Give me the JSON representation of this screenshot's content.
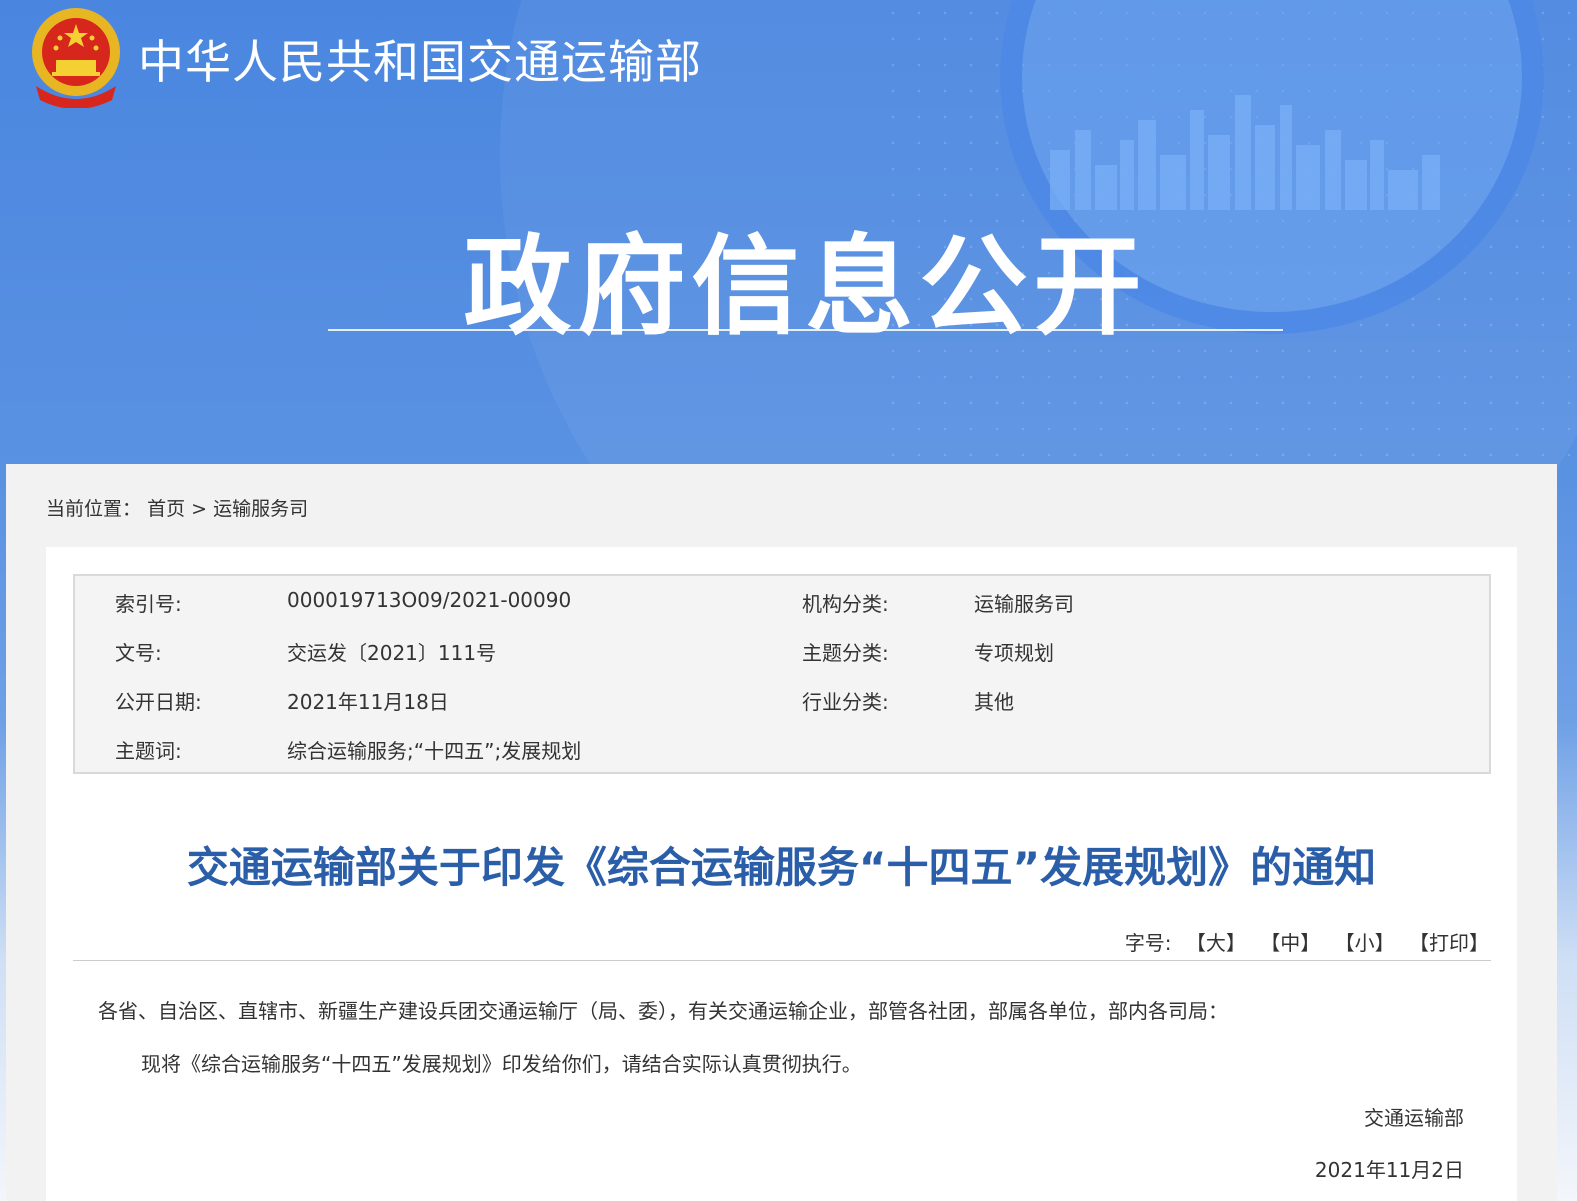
{
  "header": {
    "ministry_name": "中华人民共和国交通运输部",
    "section_title": "政府信息公开"
  },
  "breadcrumb": {
    "prefix": "当前位置：",
    "home": "首页",
    "separator": ">",
    "current": "运输服务司"
  },
  "meta": {
    "index_label": "索引号:",
    "index_value": "000019713O09/2021-00090",
    "org_label": "机构分类:",
    "org_value": "运输服务司",
    "docno_label": "文号:",
    "docno_value": "交运发〔2021〕111号",
    "topic_label": "主题分类:",
    "topic_value": "专项规划",
    "date_label": "公开日期:",
    "date_value": "2021年11月18日",
    "industry_label": "行业分类:",
    "industry_value": "其他",
    "keywords_label": "主题词:",
    "keywords_value": "综合运输服务;“十四五”;发展规划"
  },
  "article": {
    "title": "交通运输部关于印发《综合运输服务“十四五”发展规划》的通知",
    "font_size_label": "字号:",
    "font_large": "【大】",
    "font_medium": "【中】",
    "font_small": "【小】",
    "print": "【打印】",
    "addressee": "各省、自治区、直辖市、新疆生产建设兵团交通运输厅（局、委），有关交通运输企业，部管各社团，部属各单位，部内各司局：",
    "body": "现将《综合运输服务“十四五”发展规划》印发给你们，请结合实际认真贯彻执行。",
    "signature": "交通运输部",
    "sign_date": "2021年11月2日"
  },
  "colors": {
    "banner_blue": "#4a86e0",
    "title_blue": "#2a5ea8"
  }
}
